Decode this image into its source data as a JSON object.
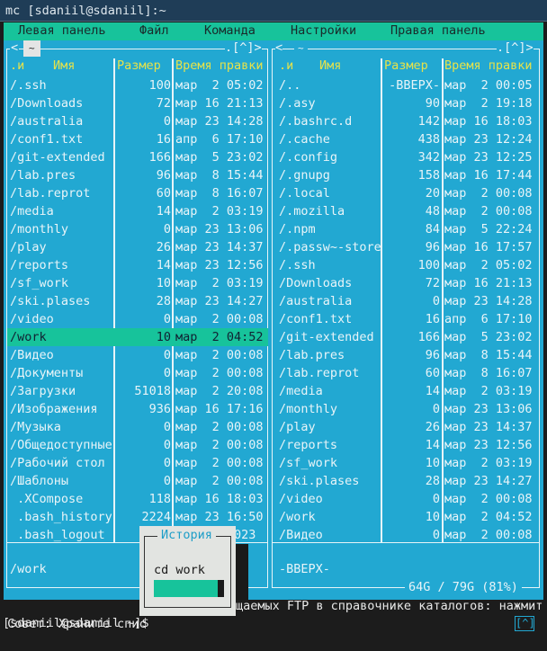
{
  "window": {
    "title": "mc [sdaniil@sdaniil]:~"
  },
  "menu": [
    "Левая панель",
    "Файл",
    "Команда",
    "Настройки",
    "Правая панель"
  ],
  "colors": {
    "panel_bg": "#22a8d2",
    "menu_bg": "#17c39b",
    "header": "#e6e24a",
    "selection": "#17c39b",
    "dialog_bg": "#e2e4e1"
  },
  "left_panel": {
    "path": "~",
    "controls": ".[^]>",
    "nav": "<",
    "sort": ".и",
    "col_name": "Имя",
    "col_size": "Размер",
    "col_time": "Время правки",
    "rows": [
      [
        "/.ssh",
        "100",
        "мар  2 05:02"
      ],
      [
        "/Downloads",
        "72",
        "мар 16 21:13"
      ],
      [
        "/australia",
        "0",
        "мар 23 14:28"
      ],
      [
        "/conf1.txt",
        "16",
        "апр  6 17:10"
      ],
      [
        "/git-extended",
        "166",
        "мар  5 23:02"
      ],
      [
        "/lab.pres",
        "96",
        "мар  8 15:44"
      ],
      [
        "/lab.reprot",
        "60",
        "мар  8 16:07"
      ],
      [
        "/media",
        "14",
        "мар  2 03:19"
      ],
      [
        "/monthly",
        "0",
        "мар 23 13:06"
      ],
      [
        "/play",
        "26",
        "мар 23 14:37"
      ],
      [
        "/reports",
        "14",
        "мар 23 12:56"
      ],
      [
        "/sf_work",
        "10",
        "мар  2 03:19"
      ],
      [
        "/ski.plases",
        "28",
        "мар 23 14:27"
      ],
      [
        "/video",
        "0",
        "мар  2 00:08"
      ],
      [
        "/work",
        "10",
        "мар  2 04:52"
      ],
      [
        "/Видео",
        "0",
        "мар  2 00:08"
      ],
      [
        "/Документы",
        "0",
        "мар  2 00:08"
      ],
      [
        "/Загрузки",
        "51018",
        "мар  2 20:08"
      ],
      [
        "/Изображения",
        "936",
        "мар 16 17:16"
      ],
      [
        "/Музыка",
        "0",
        "мар  2 00:08"
      ],
      [
        "/Общедоступные",
        "0",
        "мар  2 00:08"
      ],
      [
        "/Рабочий стол",
        "0",
        "мар  2 00:08"
      ],
      [
        "/Шаблоны",
        "0",
        "мар  2 00:08"
      ],
      [
        " .XCompose",
        "118",
        "мар 16 18:03"
      ],
      [
        " .bash_history",
        "2224",
        "мар 23 16:50"
      ],
      [
        " .bash_logout",
        "",
        "       2023"
      ]
    ],
    "selected_index": 14,
    "status": "/work",
    "disk": "%)"
  },
  "right_panel": {
    "path": "~",
    "controls": ".[^]>",
    "nav": "<",
    "sort": ".и",
    "col_name": "Имя",
    "col_size": "Размер",
    "col_time": "Время правки",
    "rows": [
      [
        "/..",
        "-ВВЕРХ-",
        "мар  2 00:05"
      ],
      [
        "/.asy",
        "90",
        "мар  2 19:18"
      ],
      [
        "/.bashrc.d",
        "142",
        "мар 16 18:03"
      ],
      [
        "/.cache",
        "438",
        "мар 23 12:24"
      ],
      [
        "/.config",
        "342",
        "мар 23 12:25"
      ],
      [
        "/.gnupg",
        "158",
        "мар 16 17:44"
      ],
      [
        "/.local",
        "20",
        "мар  2 00:08"
      ],
      [
        "/.mozilla",
        "48",
        "мар  2 00:08"
      ],
      [
        "/.npm",
        "84",
        "мар  5 22:24"
      ],
      [
        "/.passw~-store",
        "96",
        "мар 16 17:57"
      ],
      [
        "/.ssh",
        "100",
        "мар  2 05:02"
      ],
      [
        "/Downloads",
        "72",
        "мар 16 21:13"
      ],
      [
        "/australia",
        "0",
        "мар 23 14:28"
      ],
      [
        "/conf1.txt",
        "16",
        "апр  6 17:10"
      ],
      [
        "/git-extended",
        "166",
        "мар  5 23:02"
      ],
      [
        "/lab.pres",
        "96",
        "мар  8 15:44"
      ],
      [
        "/lab.reprot",
        "60",
        "мар  8 16:07"
      ],
      [
        "/media",
        "14",
        "мар  2 03:19"
      ],
      [
        "/monthly",
        "0",
        "мар 23 13:06"
      ],
      [
        "/play",
        "26",
        "мар 23 14:37"
      ],
      [
        "/reports",
        "14",
        "мар 23 12:56"
      ],
      [
        "/sf_work",
        "10",
        "мар  2 03:19"
      ],
      [
        "/ski.plases",
        "28",
        "мар 23 14:27"
      ],
      [
        "/video",
        "0",
        "мар  2 00:08"
      ],
      [
        "/work",
        "10",
        "мар  2 04:52"
      ],
      [
        "/Видео",
        "0",
        "мар  2 00:08"
      ]
    ],
    "status": "-ВВЕРХ-",
    "disk": "64G / 79G (81%)"
  },
  "history_dialog": {
    "title": "История",
    "item": "cd work"
  },
  "hint": {
    "part1": "Совет: Храните спис",
    "part2": "щаемых FTP в справочнике каталогов: нажмит"
  },
  "prompt": "[sdaniil@sdaniil ~]$",
  "corner_button": "[^]"
}
